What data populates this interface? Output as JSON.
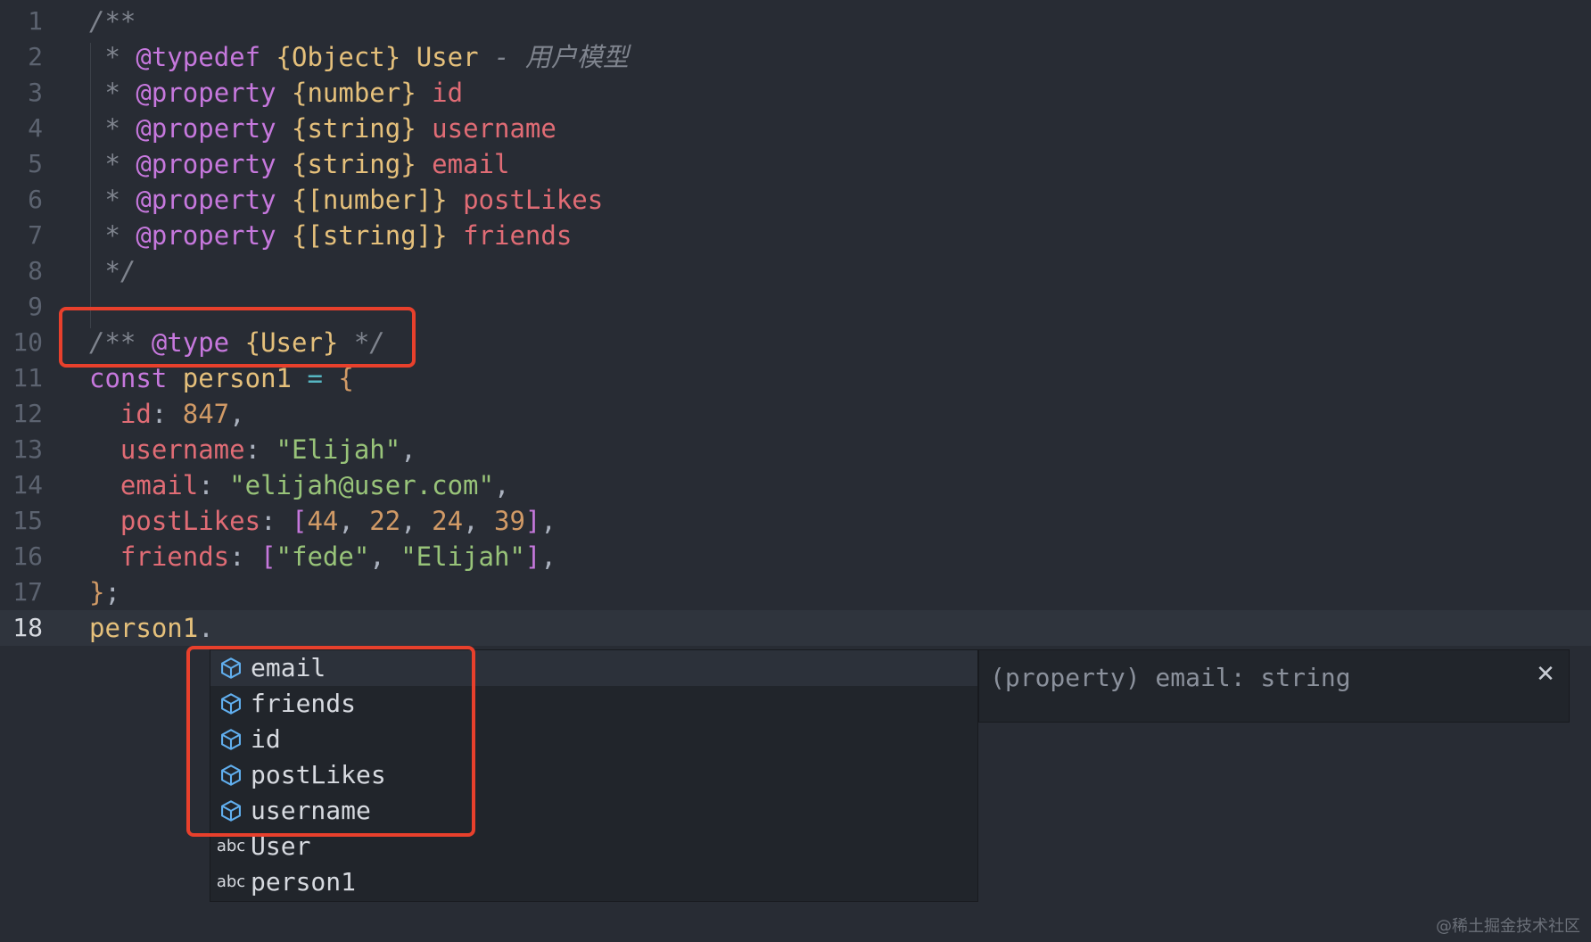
{
  "editor": {
    "lines": [
      {
        "n": "1",
        "tokens": [
          {
            "t": "/**",
            "c": "comment"
          }
        ]
      },
      {
        "n": "2",
        "tokens": [
          {
            "t": " * ",
            "c": "comment"
          },
          {
            "t": "@typedef",
            "c": "tag"
          },
          {
            "t": " ",
            "c": "plain"
          },
          {
            "t": "{Object}",
            "c": "type"
          },
          {
            "t": " ",
            "c": "plain"
          },
          {
            "t": "User",
            "c": "var"
          },
          {
            "t": " - 用户模型",
            "c": "comment"
          }
        ]
      },
      {
        "n": "3",
        "tokens": [
          {
            "t": " * ",
            "c": "comment"
          },
          {
            "t": "@property",
            "c": "tag"
          },
          {
            "t": " ",
            "c": "plain"
          },
          {
            "t": "{number}",
            "c": "type"
          },
          {
            "t": " ",
            "c": "plain"
          },
          {
            "t": "id",
            "c": "name"
          }
        ]
      },
      {
        "n": "4",
        "tokens": [
          {
            "t": " * ",
            "c": "comment"
          },
          {
            "t": "@property",
            "c": "tag"
          },
          {
            "t": " ",
            "c": "plain"
          },
          {
            "t": "{string}",
            "c": "type"
          },
          {
            "t": " ",
            "c": "plain"
          },
          {
            "t": "username",
            "c": "name"
          }
        ]
      },
      {
        "n": "5",
        "tokens": [
          {
            "t": " * ",
            "c": "comment"
          },
          {
            "t": "@property",
            "c": "tag"
          },
          {
            "t": " ",
            "c": "plain"
          },
          {
            "t": "{string}",
            "c": "type"
          },
          {
            "t": " ",
            "c": "plain"
          },
          {
            "t": "email",
            "c": "name"
          }
        ]
      },
      {
        "n": "6",
        "tokens": [
          {
            "t": " * ",
            "c": "comment"
          },
          {
            "t": "@property",
            "c": "tag"
          },
          {
            "t": " ",
            "c": "plain"
          },
          {
            "t": "{[number]}",
            "c": "type"
          },
          {
            "t": " ",
            "c": "plain"
          },
          {
            "t": "postLikes",
            "c": "name"
          }
        ]
      },
      {
        "n": "7",
        "tokens": [
          {
            "t": " * ",
            "c": "comment"
          },
          {
            "t": "@property",
            "c": "tag"
          },
          {
            "t": " ",
            "c": "plain"
          },
          {
            "t": "{[string]}",
            "c": "type"
          },
          {
            "t": " ",
            "c": "plain"
          },
          {
            "t": "friends",
            "c": "name"
          }
        ]
      },
      {
        "n": "8",
        "tokens": [
          {
            "t": " */",
            "c": "comment"
          }
        ]
      },
      {
        "n": "9",
        "tokens": []
      },
      {
        "n": "10",
        "tokens": [
          {
            "t": "/** ",
            "c": "comment"
          },
          {
            "t": "@type",
            "c": "tag"
          },
          {
            "t": " ",
            "c": "plain"
          },
          {
            "t": "{User}",
            "c": "type"
          },
          {
            "t": " */",
            "c": "comment"
          }
        ]
      },
      {
        "n": "11",
        "tokens": [
          {
            "t": "const",
            "c": "keyword"
          },
          {
            "t": " ",
            "c": "plain"
          },
          {
            "t": "person1",
            "c": "var"
          },
          {
            "t": " ",
            "c": "plain"
          },
          {
            "t": "=",
            "c": "op"
          },
          {
            "t": " ",
            "c": "plain"
          },
          {
            "t": "{",
            "c": "brace2"
          }
        ]
      },
      {
        "n": "12",
        "tokens": [
          {
            "t": "  ",
            "c": "plain"
          },
          {
            "t": "id",
            "c": "prop"
          },
          {
            "t": ": ",
            "c": "plain"
          },
          {
            "t": "847",
            "c": "num"
          },
          {
            "t": ",",
            "c": "plain"
          }
        ]
      },
      {
        "n": "13",
        "tokens": [
          {
            "t": "  ",
            "c": "plain"
          },
          {
            "t": "username",
            "c": "prop"
          },
          {
            "t": ": ",
            "c": "plain"
          },
          {
            "t": "\"Elijah\"",
            "c": "str"
          },
          {
            "t": ",",
            "c": "plain"
          }
        ]
      },
      {
        "n": "14",
        "tokens": [
          {
            "t": "  ",
            "c": "plain"
          },
          {
            "t": "email",
            "c": "prop"
          },
          {
            "t": ": ",
            "c": "plain"
          },
          {
            "t": "\"elijah@user.com\"",
            "c": "str"
          },
          {
            "t": ",",
            "c": "plain"
          }
        ]
      },
      {
        "n": "15",
        "tokens": [
          {
            "t": "  ",
            "c": "plain"
          },
          {
            "t": "postLikes",
            "c": "prop"
          },
          {
            "t": ": ",
            "c": "plain"
          },
          {
            "t": "[",
            "c": "bracket"
          },
          {
            "t": "44",
            "c": "num"
          },
          {
            "t": ", ",
            "c": "plain"
          },
          {
            "t": "22",
            "c": "num"
          },
          {
            "t": ", ",
            "c": "plain"
          },
          {
            "t": "24",
            "c": "num"
          },
          {
            "t": ", ",
            "c": "plain"
          },
          {
            "t": "39",
            "c": "num"
          },
          {
            "t": "]",
            "c": "bracket"
          },
          {
            "t": ",",
            "c": "plain"
          }
        ]
      },
      {
        "n": "16",
        "tokens": [
          {
            "t": "  ",
            "c": "plain"
          },
          {
            "t": "friends",
            "c": "prop"
          },
          {
            "t": ": ",
            "c": "plain"
          },
          {
            "t": "[",
            "c": "bracket"
          },
          {
            "t": "\"fede\"",
            "c": "str"
          },
          {
            "t": ", ",
            "c": "plain"
          },
          {
            "t": "\"Elijah\"",
            "c": "str"
          },
          {
            "t": "]",
            "c": "bracket"
          },
          {
            "t": ",",
            "c": "plain"
          }
        ]
      },
      {
        "n": "17",
        "tokens": [
          {
            "t": "}",
            "c": "brace2"
          },
          {
            "t": ";",
            "c": "plain"
          }
        ]
      },
      {
        "n": "18",
        "tokens": [
          {
            "t": "person1",
            "c": "var"
          },
          {
            "t": ".",
            "c": "plain"
          }
        ],
        "current": true
      }
    ]
  },
  "suggest": {
    "items": [
      {
        "label": "email",
        "kind": "property-icon",
        "selected": true
      },
      {
        "label": "friends",
        "kind": "property-icon"
      },
      {
        "label": "id",
        "kind": "property-icon"
      },
      {
        "label": "postLikes",
        "kind": "property-icon"
      },
      {
        "label": "username",
        "kind": "property-icon"
      },
      {
        "label": "User",
        "kind": "text",
        "kind_label": "abc"
      },
      {
        "label": "person1",
        "kind": "text",
        "kind_label": "abc"
      }
    ]
  },
  "detail": {
    "text": "(property) email: string",
    "close_icon": "close-icon",
    "close_glyph": "✕"
  },
  "watermark": "@稀土掘金技术社区",
  "colors": {
    "background": "#282c34",
    "highlight_box": "#e8402c",
    "property_icon": "#61afef"
  }
}
